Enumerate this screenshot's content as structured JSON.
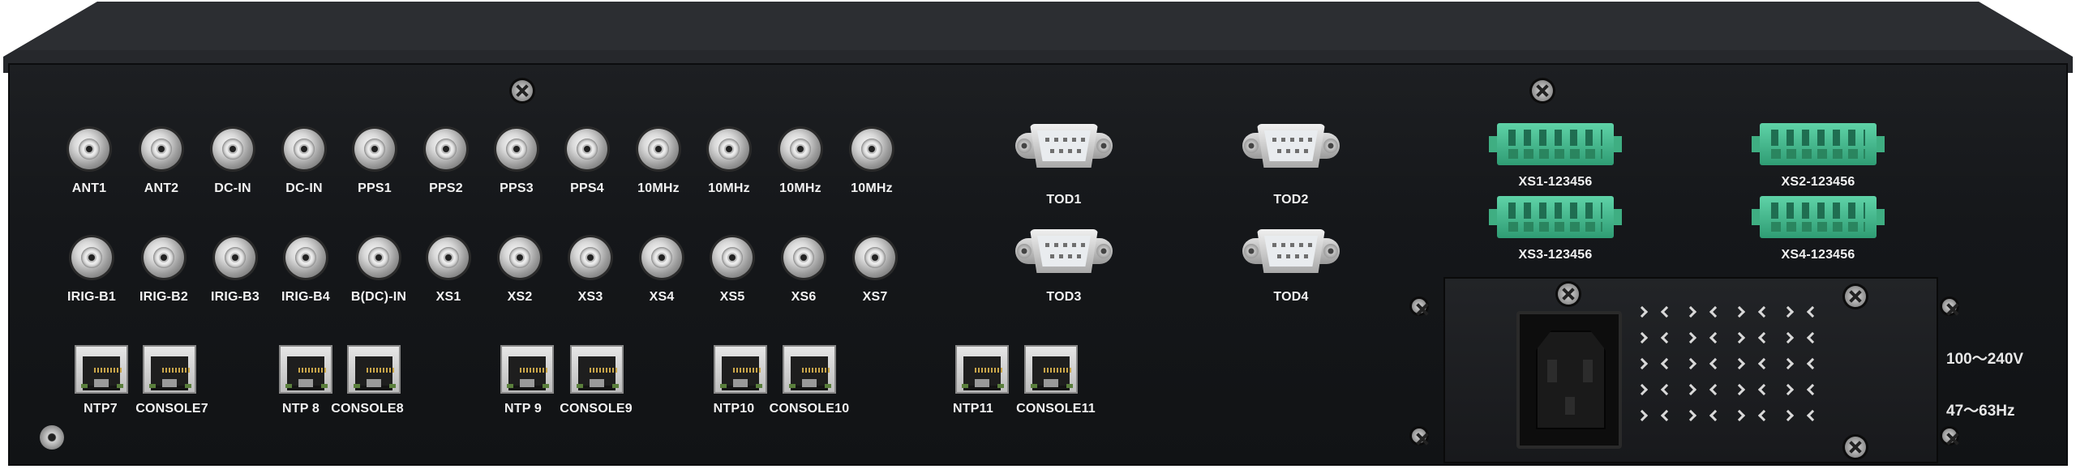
{
  "device": "rear-panel",
  "row1_labels": [
    "ANT1",
    "ANT2",
    "DC-IN",
    "DC-IN",
    "PPS1",
    "PPS2",
    "PPS3",
    "PPS4",
    "10MHz",
    "10MHz",
    "10MHz",
    "10MHz"
  ],
  "row2_labels": [
    "IRIG-B1",
    "IRIG-B2",
    "IRIG-B3",
    "IRIG-B4",
    "B(DC)-IN",
    "XS1",
    "XS2",
    "XS3",
    "XS4",
    "XS5",
    "XS6",
    "XS7"
  ],
  "ethernet_labels": [
    "NTP7",
    "CONSOLE7",
    "NTP 8",
    "CONSOLE8",
    "NTP 9",
    "CONSOLE9",
    "NTP10",
    "CONSOLE10",
    "NTP11",
    "CONSOLE11"
  ],
  "tod_labels": [
    "TOD1",
    "TOD2",
    "TOD3",
    "TOD4"
  ],
  "terminal_labels": [
    "XS1-123456",
    "XS2-123456",
    "XS3-123456",
    "XS4-123456"
  ],
  "power": {
    "voltage": "100～240V",
    "frequency": "47～63Hz"
  },
  "colors": {
    "panel": "#15171a",
    "terminal": "#3fb889",
    "label": "#f2f2f2"
  }
}
